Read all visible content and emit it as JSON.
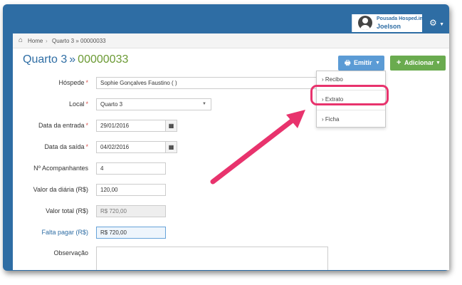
{
  "header": {
    "org": "Pousada Hosped.in",
    "user": "Joelson",
    "gear_icon": "gear-icon"
  },
  "breadcrumb": {
    "home": "Home",
    "separator": "›",
    "current": "Quarto 3 » 00000033"
  },
  "page": {
    "title_room": "Quarto 3",
    "title_sep": "»",
    "title_id": "00000033"
  },
  "buttons": {
    "emitir": "Emitir",
    "adicionar": "Adicionar"
  },
  "dropdown": {
    "items": [
      "Recibo",
      "Extrato",
      "Ficha"
    ],
    "highlighted": "Extrato"
  },
  "form": {
    "hospede": {
      "label": "Hóspede",
      "required": "*",
      "value": "Sophie Gonçalves Faustino ( )"
    },
    "local": {
      "label": "Local",
      "required": "*",
      "value": "Quarto 3"
    },
    "entrada": {
      "label": "Data da entrada",
      "required": "*",
      "value": "29/01/2016"
    },
    "saida": {
      "label": "Data da saída",
      "required": "*",
      "value": "04/02/2016"
    },
    "acompanhantes": {
      "label": "Nº Acompanhantes",
      "value": "4"
    },
    "diaria": {
      "label": "Valor da diária (R$)",
      "value": "120,00"
    },
    "total": {
      "label": "Valor total (R$)",
      "value": "R$ 720,00"
    },
    "falta": {
      "label": "Falta pagar (R$)",
      "value": "R$ 720,00"
    },
    "observacao": {
      "label": "Observação",
      "value": ""
    }
  },
  "colors": {
    "frame": "#2e6da4",
    "accent_blue": "#5b9bd5",
    "accent_green": "#6aab4f",
    "highlight": "#e8336d"
  }
}
